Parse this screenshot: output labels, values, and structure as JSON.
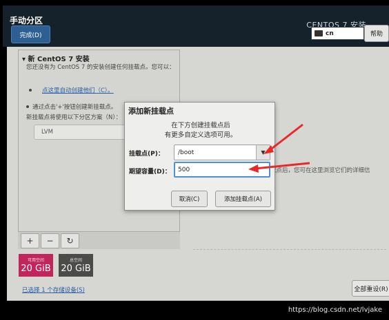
{
  "header": {
    "title": "手动分区",
    "done_label": "完成(D)",
    "product": "CENTOS 7 安装",
    "keyboard": "cn",
    "help_label": "帮助"
  },
  "left_panel": {
    "title": "新 CentOS 7 安装",
    "description": "您还没有为 CentOS 7 的安装创建任何挂载点。您可以：",
    "auto_link": "点这里自动创建他们（C）。",
    "manual_hint": "通过点击'+'按钮创建新挂载点。",
    "scheme_hint": "新挂载点将使用以下分区方案（N）：",
    "scheme_value": "LVM"
  },
  "toolbar": {
    "add": "+",
    "remove": "−",
    "refresh": "↻"
  },
  "space": {
    "available_label": "可用空间",
    "available_value": "20 GiB",
    "total_label": "总空间",
    "total_value": "20 GiB"
  },
  "storage_link": "已选择 1 个存储设备(S)",
  "reset_label": "全部重设(R)",
  "detail_hint": "载点后，您可在这里浏览它们的详细信",
  "dialog": {
    "title": "添加新挂载点",
    "desc_line1": "在下方创建挂载点后",
    "desc_line2": "有更多自定义选项可用。",
    "mount_label": "挂载点(P)：",
    "mount_value": "/boot",
    "capacity_label": "期望容量(D)：",
    "capacity_value": "500",
    "cancel_label": "取消(C)",
    "add_label": "添加挂载点(A)"
  },
  "colors": {
    "header_bg": "#15222c",
    "available_bg": "#c2245c",
    "total_bg": "#4b4b49",
    "arrow": "#e8292a",
    "focus": "#4a90d9"
  },
  "watermark": "https://blog.csdn.net/lvjake"
}
